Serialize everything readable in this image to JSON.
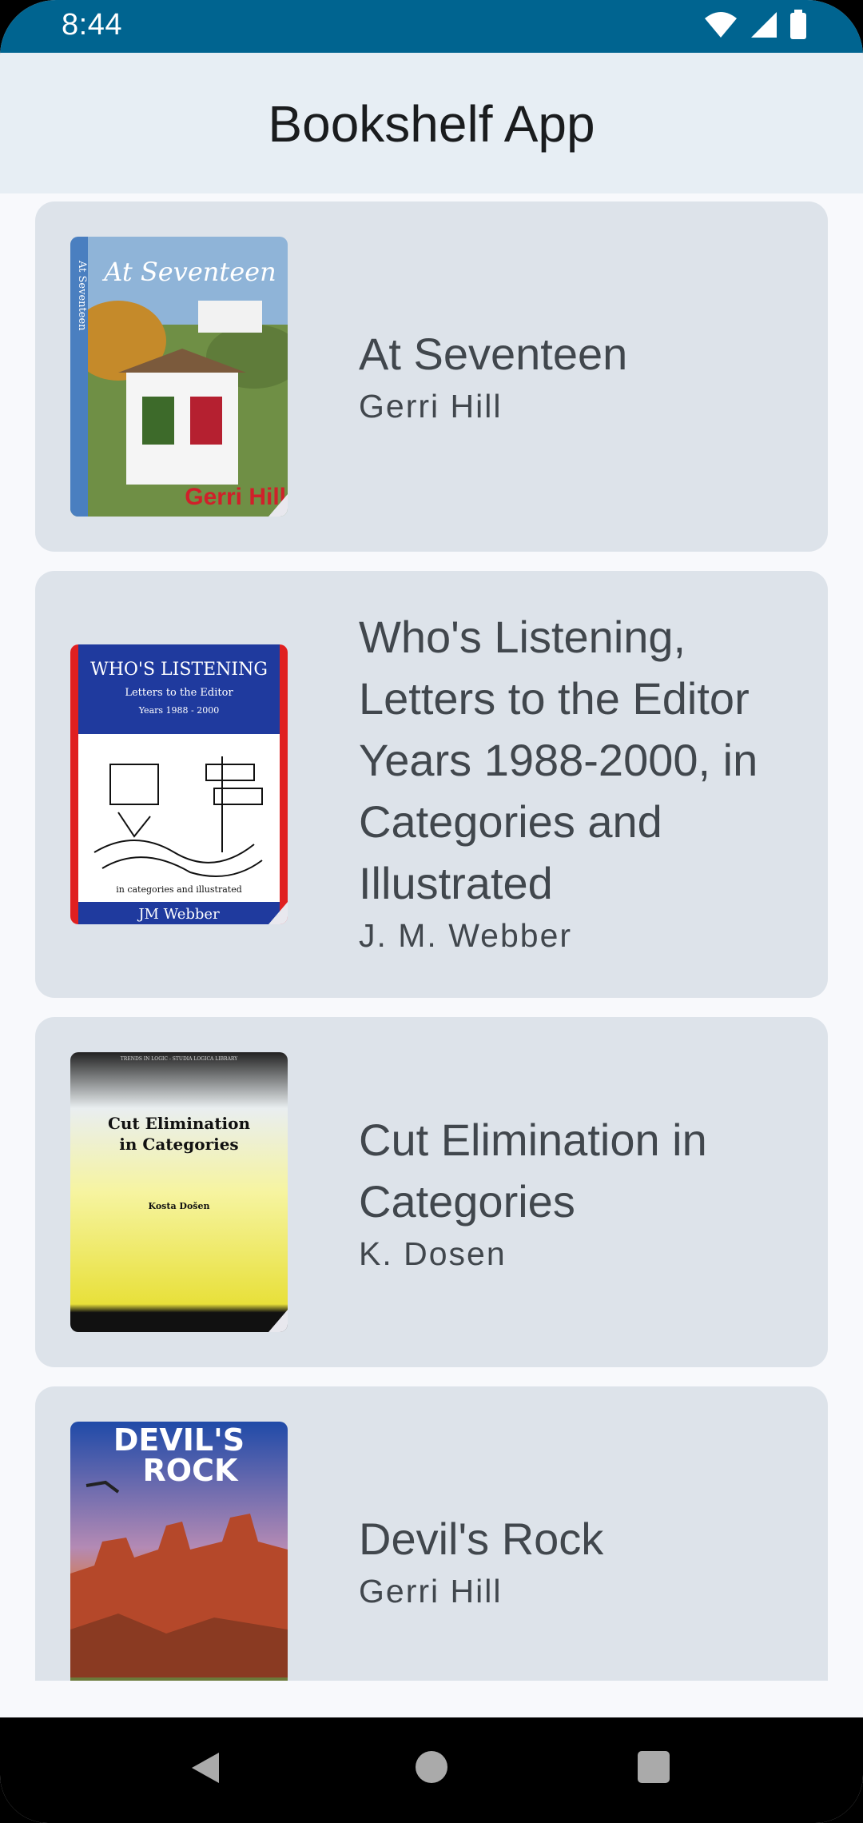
{
  "status_bar": {
    "time": "8:44",
    "icons": [
      "wifi-icon",
      "signal-icon",
      "battery-icon"
    ]
  },
  "app_bar": {
    "title": "Bookshelf App"
  },
  "books": [
    {
      "title": "At Seventeen",
      "author": "Gerri Hill",
      "cover": {
        "spine_text": "At Seventeen",
        "title_text": "At Seventeen",
        "author_text": "Gerri Hill"
      }
    },
    {
      "title": "Who's Listening, Letters to the Editor Years 1988-2000, in Categories and Illustrated",
      "author": "J. M. Webber",
      "cover": {
        "title_text": "WHO'S LISTENING",
        "sub1": "Letters to the Editor",
        "sub2": "Years 1988 - 2000",
        "bottom_line": "in categories and illustrated",
        "author_text": "JM Webber"
      }
    },
    {
      "title": "Cut Elimination in Categories",
      "author": "K. Dosen",
      "cover": {
        "series_text": "TRENDS IN LOGIC - STUDIA LOGICA LIBRARY",
        "title_line1": "Cut Elimination",
        "title_line2": "in Categories",
        "author_text": "Kosta Došen"
      }
    },
    {
      "title": "Devil's Rock",
      "author": "Gerri Hill",
      "cover": {
        "title_line1": "DEVIL'S",
        "title_line2": "ROCK"
      }
    }
  ],
  "nav_bar": {
    "buttons": [
      "back-icon",
      "home-icon",
      "recents-icon"
    ]
  },
  "colors": {
    "status_bar": "#006490",
    "app_bar": "#e7eef4",
    "card": "#dde3ea",
    "background": "#f8f9fc"
  }
}
